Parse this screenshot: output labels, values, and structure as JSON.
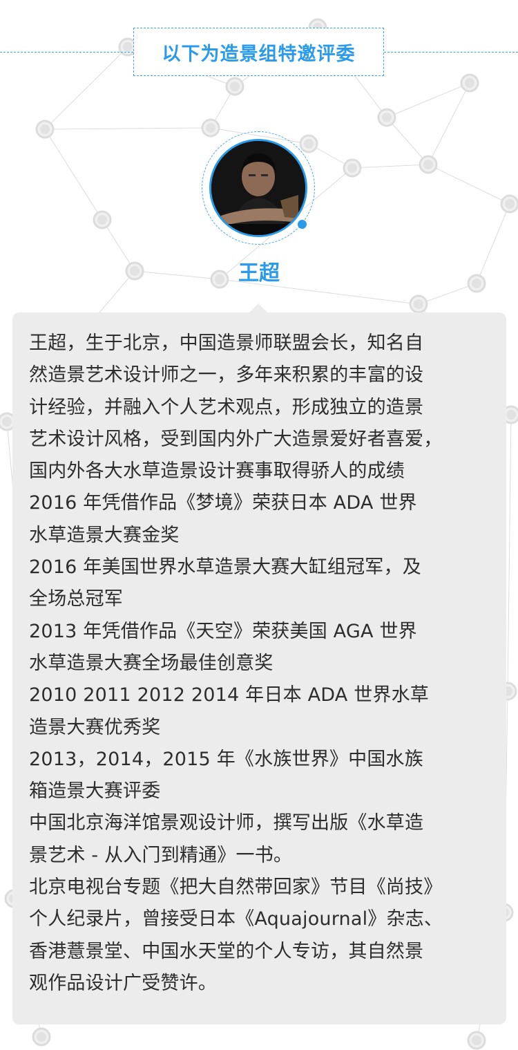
{
  "header": {
    "title": "以下为造景组特邀评委"
  },
  "profile": {
    "name": "王超"
  },
  "bio": {
    "lines": [
      "王超，生于北京，中国造景师联盟会长，知名自",
      "然造景艺术设计师之一，多年来积累的丰富的设",
      "计经验，并融入个人艺术观点，形成独立的造景",
      "艺术设计风格，受到国内外广大造景爱好者喜爱，",
      "国内外各大水草造景设计赛事取得骄人的成绩",
      "2016 年凭借作品《梦境》荣获日本 ADA 世界",
      "水草造景大赛金奖",
      "2016 年美国世界水草造景大赛大缸组冠军，及",
      "全场总冠军",
      "2013 年凭借作品《天空》荣获美国 AGA 世界",
      "水草造景大赛全场最佳创意奖",
      "2010 2011 2012 2014 年日本 ADA 世界水草",
      "造景大赛优秀奖",
      "2013，2014，2015 年《水族世界》中国水族",
      "箱造景大赛评委",
      "中国北京海洋馆景观设计师，撰写出版《水草造",
      "景艺术 - 从入门到精通》一书。",
      "北京电视台专题《把大自然带回家》节目《尚技》",
      "个人纪录片，曾接受日本《Aquajournal》杂志、",
      "香港薏景堂、中国水天堂的个人专访，其自然景",
      "观作品设计广受赞许。"
    ]
  },
  "colors": {
    "accent": "#2a9bea",
    "card_background": "#ececec",
    "text": "#2d2d2d",
    "network": "#dcdcdc"
  },
  "icons": {
    "avatar": "portrait-photo",
    "status": "blue-dot-icon"
  }
}
